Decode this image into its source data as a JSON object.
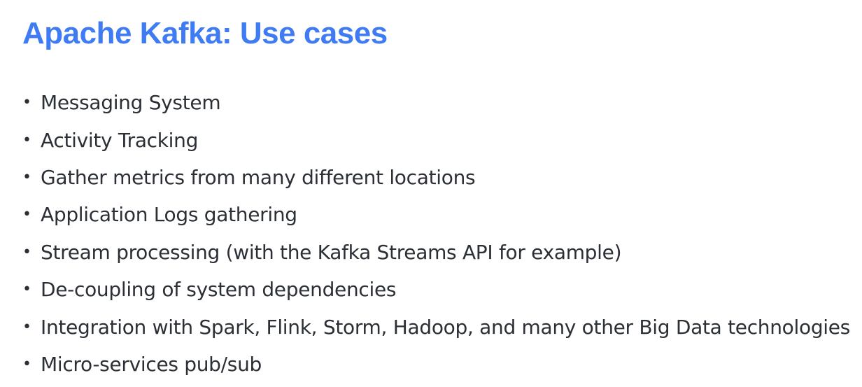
{
  "slide": {
    "title": "Apache Kafka: Use cases",
    "accent_color": "#3F7BF2",
    "bullet_glyph": "•",
    "bullets": [
      "Messaging System",
      "Activity Tracking",
      "Gather metrics from many different locations",
      "Application Logs gathering",
      "Stream processing (with the Kafka Streams API for example)",
      "De-coupling of system dependencies",
      "Integration with Spark, Flink, Storm, Hadoop, and many other Big Data technologies",
      "Micro-services pub/sub"
    ]
  }
}
